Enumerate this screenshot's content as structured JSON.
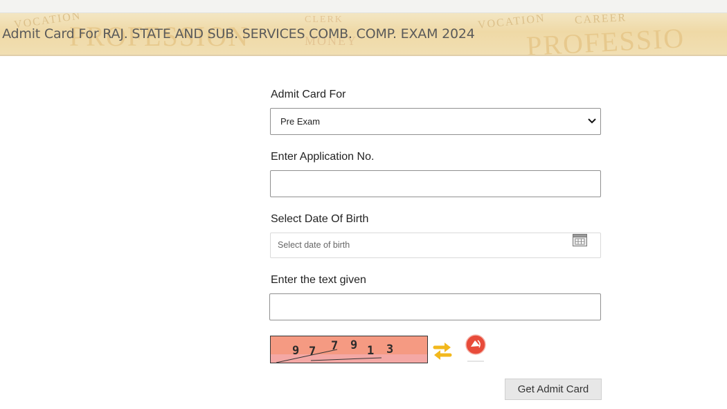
{
  "banner": {
    "title": "t Admit Card For RAJ. STATE AND SUB. SERVICES COMB. COMP. EXAM 2024",
    "background_words": [
      "PROFESSION",
      "PROFESSIO",
      "VOCATION",
      "VOCATION",
      "CLERK",
      "CAREER",
      "MONEY"
    ]
  },
  "form": {
    "admit_card_for": {
      "label": "Admit Card For",
      "selected": "Pre Exam"
    },
    "application_no": {
      "label": "Enter Application No.",
      "value": ""
    },
    "date_of_birth": {
      "label": "Select Date Of Birth",
      "placeholder": "Select date of birth"
    },
    "captcha_input": {
      "label": "Enter the text given",
      "value": ""
    },
    "captcha": {
      "chars": [
        "9",
        "7",
        "7",
        "9",
        "1",
        "3"
      ]
    },
    "submit_label": "Get Admit Card"
  },
  "colors": {
    "banner_bg": "#efd9a6",
    "captcha_bg": "#f59a82",
    "button_bg": "#e7e7e7",
    "refresh_icon": "#f2b81d",
    "audio_icon": "#e84b3a"
  },
  "icons": {
    "dropdown": "chevron-down-icon",
    "calendar": "calendar-icon",
    "refresh": "refresh-icon",
    "audio": "audio-icon"
  }
}
